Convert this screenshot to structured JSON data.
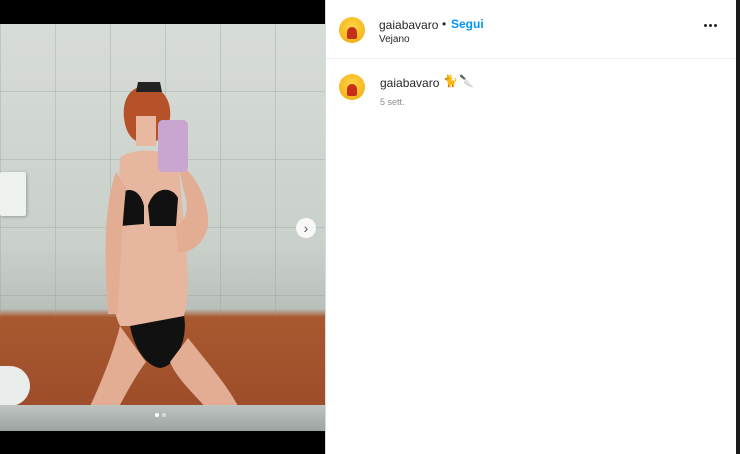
{
  "post": {
    "username": "gaiabavaro",
    "separator": "•",
    "follow_label": "Segui",
    "location": "Vejano",
    "more_icon": "more-horizontal-icon"
  },
  "caption": {
    "username": "gaiabavaro",
    "emoji_1": "🐈",
    "emoji_2": "🔪",
    "timestamp": "5 sett."
  },
  "carousel": {
    "current": 1,
    "total": 2,
    "next_icon": "chevron-right-icon",
    "next_glyph": "›"
  },
  "colors": {
    "accent": "#0095f6",
    "text": "#262626",
    "muted": "#8e8e8e"
  }
}
